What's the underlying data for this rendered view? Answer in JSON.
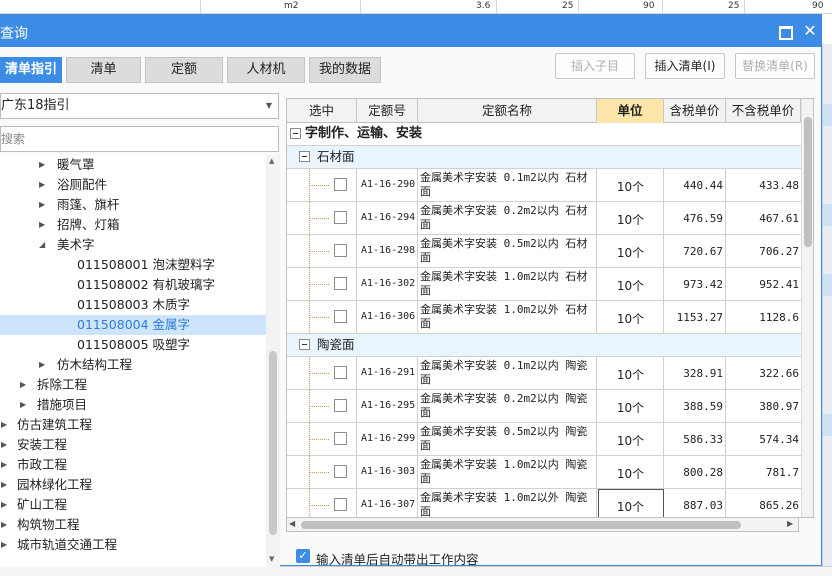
{
  "background": {
    "top_cells": [
      "m2",
      "3.6",
      "25",
      "90",
      "25",
      "90"
    ]
  },
  "dialog": {
    "title": "查询",
    "maximize_icon": "maximize-icon",
    "close_icon": "close-icon",
    "close_glyph": "✕"
  },
  "tabs": [
    "清单指引",
    "清单",
    "定额",
    "人材机",
    "我的数据"
  ],
  "toolbar": {
    "insert_child": "插入子目",
    "insert_list": "插入清单(I)",
    "replace_list": "替换清单(R)"
  },
  "left": {
    "selected_guide": "广东18指引",
    "search_placeholder": "搜索",
    "tree": [
      {
        "label": "暖气罩",
        "toggle": "▶"
      },
      {
        "label": "浴厕配件",
        "toggle": "▶"
      },
      {
        "label": "雨篷、旗杆",
        "toggle": "▶"
      },
      {
        "label": "招牌、灯箱",
        "toggle": "▶"
      },
      {
        "label": "美术字",
        "toggle": "◢"
      },
      {
        "label": "011508001  泡沫塑料字",
        "toggle": ""
      },
      {
        "label": "011508002  有机玻璃字",
        "toggle": ""
      },
      {
        "label": "011508003  木质字",
        "toggle": ""
      },
      {
        "label": "011508004  金属字",
        "toggle": ""
      },
      {
        "label": "011508005  吸塑字",
        "toggle": ""
      },
      {
        "label": "仿木结构工程",
        "toggle": "▶"
      },
      {
        "label": "拆除工程",
        "toggle": "▶"
      },
      {
        "label": "措施项目",
        "toggle": "▶"
      },
      {
        "label": "仿古建筑工程",
        "toggle": "▶"
      },
      {
        "label": "安装工程",
        "toggle": "▶"
      },
      {
        "label": "市政工程",
        "toggle": "▶"
      },
      {
        "label": "园林绿化工程",
        "toggle": "▶"
      },
      {
        "label": "矿山工程",
        "toggle": "▶"
      },
      {
        "label": "构筑物工程",
        "toggle": "▶"
      },
      {
        "label": "城市轨道交通工程",
        "toggle": "▶"
      }
    ]
  },
  "grid": {
    "headers": [
      "选中",
      "定额号",
      "定额名称",
      "单位",
      "含税单价",
      "不含税单价"
    ],
    "group_label": "字制作、运输、安装",
    "subgroups": [
      {
        "label": "石材面",
        "rows": [
          {
            "code": "A1-16-290",
            "name": "金属美术字安装 0.1m2以内 石材面",
            "unit": "10个",
            "tax_price": "440.44",
            "notax_price": "433.48"
          },
          {
            "code": "A1-16-294",
            "name": "金属美术字安装 0.2m2以内 石材面",
            "unit": "10个",
            "tax_price": "476.59",
            "notax_price": "467.61"
          },
          {
            "code": "A1-16-298",
            "name": "金属美术字安装 0.5m2以内 石材面",
            "unit": "10个",
            "tax_price": "720.67",
            "notax_price": "706.27"
          },
          {
            "code": "A1-16-302",
            "name": "金属美术字安装 1.0m2以内 石材面",
            "unit": "10个",
            "tax_price": "973.42",
            "notax_price": "952.41"
          },
          {
            "code": "A1-16-306",
            "name": "金属美术字安装 1.0m2以外 石材面",
            "unit": "10个",
            "tax_price": "1153.27",
            "notax_price": "1128.6"
          }
        ]
      },
      {
        "label": "陶瓷面",
        "rows": [
          {
            "code": "A1-16-291",
            "name": "金属美术字安装 0.1m2以内 陶瓷面",
            "unit": "10个",
            "tax_price": "328.91",
            "notax_price": "322.66"
          },
          {
            "code": "A1-16-295",
            "name": "金属美术字安装 0.2m2以内 陶瓷面",
            "unit": "10个",
            "tax_price": "388.59",
            "notax_price": "380.97"
          },
          {
            "code": "A1-16-299",
            "name": "金属美术字安装 0.5m2以内 陶瓷面",
            "unit": "10个",
            "tax_price": "586.33",
            "notax_price": "574.34"
          },
          {
            "code": "A1-16-303",
            "name": "金属美术字安装 1.0m2以内 陶瓷面",
            "unit": "10个",
            "tax_price": "800.28",
            "notax_price": "781.7"
          },
          {
            "code": "A1-16-307",
            "name": "金属美术字安装 1.0m2以外 陶瓷面",
            "unit": "10个",
            "tax_price": "887.03",
            "notax_price": "865.26"
          }
        ]
      }
    ]
  },
  "footer": {
    "auto_bring_label": "输入清单后自动带出工作内容",
    "auto_bring_checked": true,
    "check_glyph": "✓"
  },
  "colors": {
    "accent": "#3c8ce6",
    "selected_row": "#cde4fb",
    "header_highlight": "#fbe5a8",
    "subgroup_bg": "#e9f4fc"
  }
}
